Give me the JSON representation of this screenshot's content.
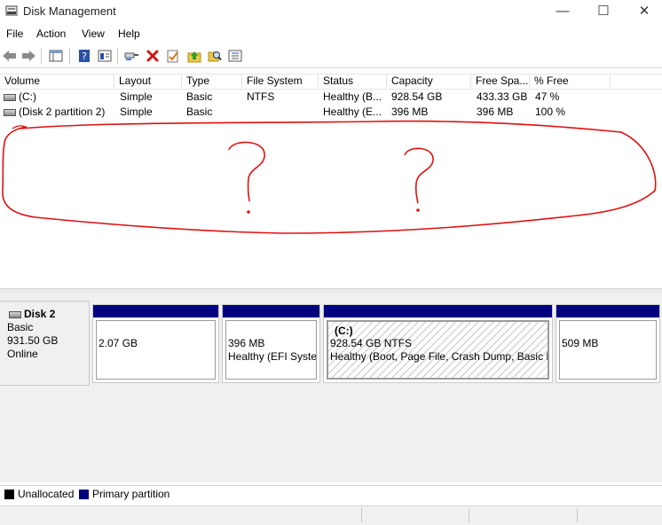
{
  "window": {
    "title": "Disk Management",
    "controls": {
      "minimize": "—",
      "maximize": "☐",
      "close": "✕"
    }
  },
  "menu": [
    "File",
    "Action",
    "View",
    "Help"
  ],
  "toolbar": {
    "buttons": [
      "back-icon",
      "forward-icon",
      "console-tree-icon",
      "help-icon",
      "properties-icon",
      "connect-icon",
      "delete-icon",
      "check-icon",
      "up-folder-icon",
      "search-icon",
      "list-icon"
    ]
  },
  "volume_table": {
    "columns": [
      "Volume",
      "Layout",
      "Type",
      "File System",
      "Status",
      "Capacity",
      "Free Spa...",
      "% Free"
    ],
    "rows": [
      {
        "volume": "(C:)",
        "layout": "Simple",
        "type": "Basic",
        "fs": "NTFS",
        "status": "Healthy (B...",
        "capacity": "928.54 GB",
        "free": "433.33 GB",
        "pct": "47 %"
      },
      {
        "volume": "(Disk 2 partition 2)",
        "layout": "Simple",
        "type": "Basic",
        "fs": "",
        "status": "Healthy (E...",
        "capacity": "396 MB",
        "free": "396 MB",
        "pct": "100 %"
      }
    ],
    "annotation_color": "#e01010"
  },
  "disk": {
    "name": "Disk 2",
    "type": "Basic",
    "size": "931.50 GB",
    "state": "Online"
  },
  "partitions": [
    {
      "line1": "2.07 GB",
      "line2": ""
    },
    {
      "line1": "396 MB",
      "line2": "Healthy (EFI Syster"
    },
    {
      "label": "(C:)",
      "line1": "928.54 GB NTFS",
      "line2": "Healthy (Boot, Page File, Crash Dump, Basic Da"
    },
    {
      "line1": "509 MB",
      "line2": ""
    }
  ],
  "legend": [
    {
      "label": "Unallocated",
      "color": "#000000"
    },
    {
      "label": "Primary partition",
      "color": "#000080"
    }
  ]
}
